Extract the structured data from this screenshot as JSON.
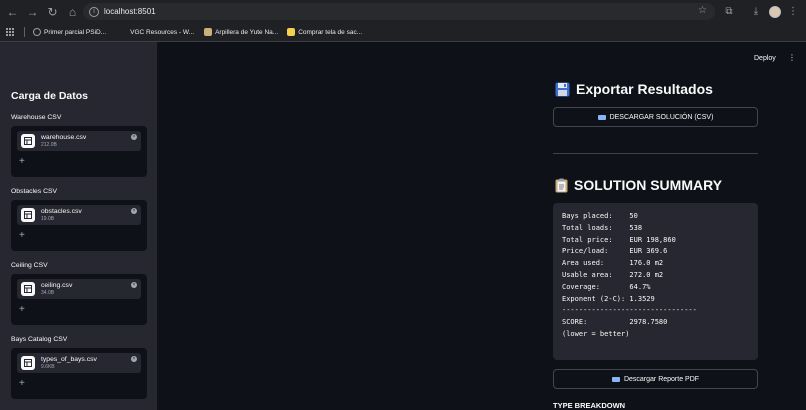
{
  "browser": {
    "url": "localhost:8501",
    "bookmarks": [
      {
        "label": "Primer parcial PSiD...",
        "color": "#8ab4f8"
      },
      {
        "label": "VGC Resources - W...",
        "color": "#202124"
      },
      {
        "label": "Arpillera de Yute Na...",
        "color": "#c9b27a"
      },
      {
        "label": "Comprar tela de sac...",
        "color": "#f4d04e"
      }
    ]
  },
  "sidebar": {
    "title": "Carga de Datos",
    "uploaders": [
      {
        "label": "Warehouse CSV",
        "file_name": "warehouse.csv",
        "file_size": "212.0B"
      },
      {
        "label": "Obstacles CSV",
        "file_name": "obstacles.csv",
        "file_size": "19.0B"
      },
      {
        "label": "Ceiling CSV",
        "file_name": "ceiling.csv",
        "file_size": "34.0B"
      },
      {
        "label": "Bays Catalog CSV",
        "file_name": "types_of_bays.csv",
        "file_size": "9.6KB"
      }
    ],
    "add_symbol": "+",
    "close_symbol": "×"
  },
  "header": {
    "deploy_label": "Deploy",
    "menu_symbol": "⋮"
  },
  "main": {
    "export_title": "Exportar Resultados",
    "download_csv_label": "DESCARGAR SOLUCIÓN (CSV)",
    "summary_title": "SOLUTION SUMMARY",
    "summary_text": "Bays placed:    50\nTotal loads:    538\nTotal price:    EUR 198,860\nPrice/load:     EUR 369.6\nArea used:      176.0 m2\nUsable area:    272.0 m2\nCoverage:       64.7%\nExponent (2-C): 1.3529\n--------------------------------\nSCORE:          2978.7580\n(lower = better)",
    "download_pdf_label": "Descargar Reporte PDF",
    "type_breakdown_title": "TYPE BREAKDOWN"
  },
  "colors": {
    "app_background": "#0e1117",
    "sidebar_background": "#262730",
    "code_background": "#262730",
    "browser_chrome": "#202124"
  }
}
